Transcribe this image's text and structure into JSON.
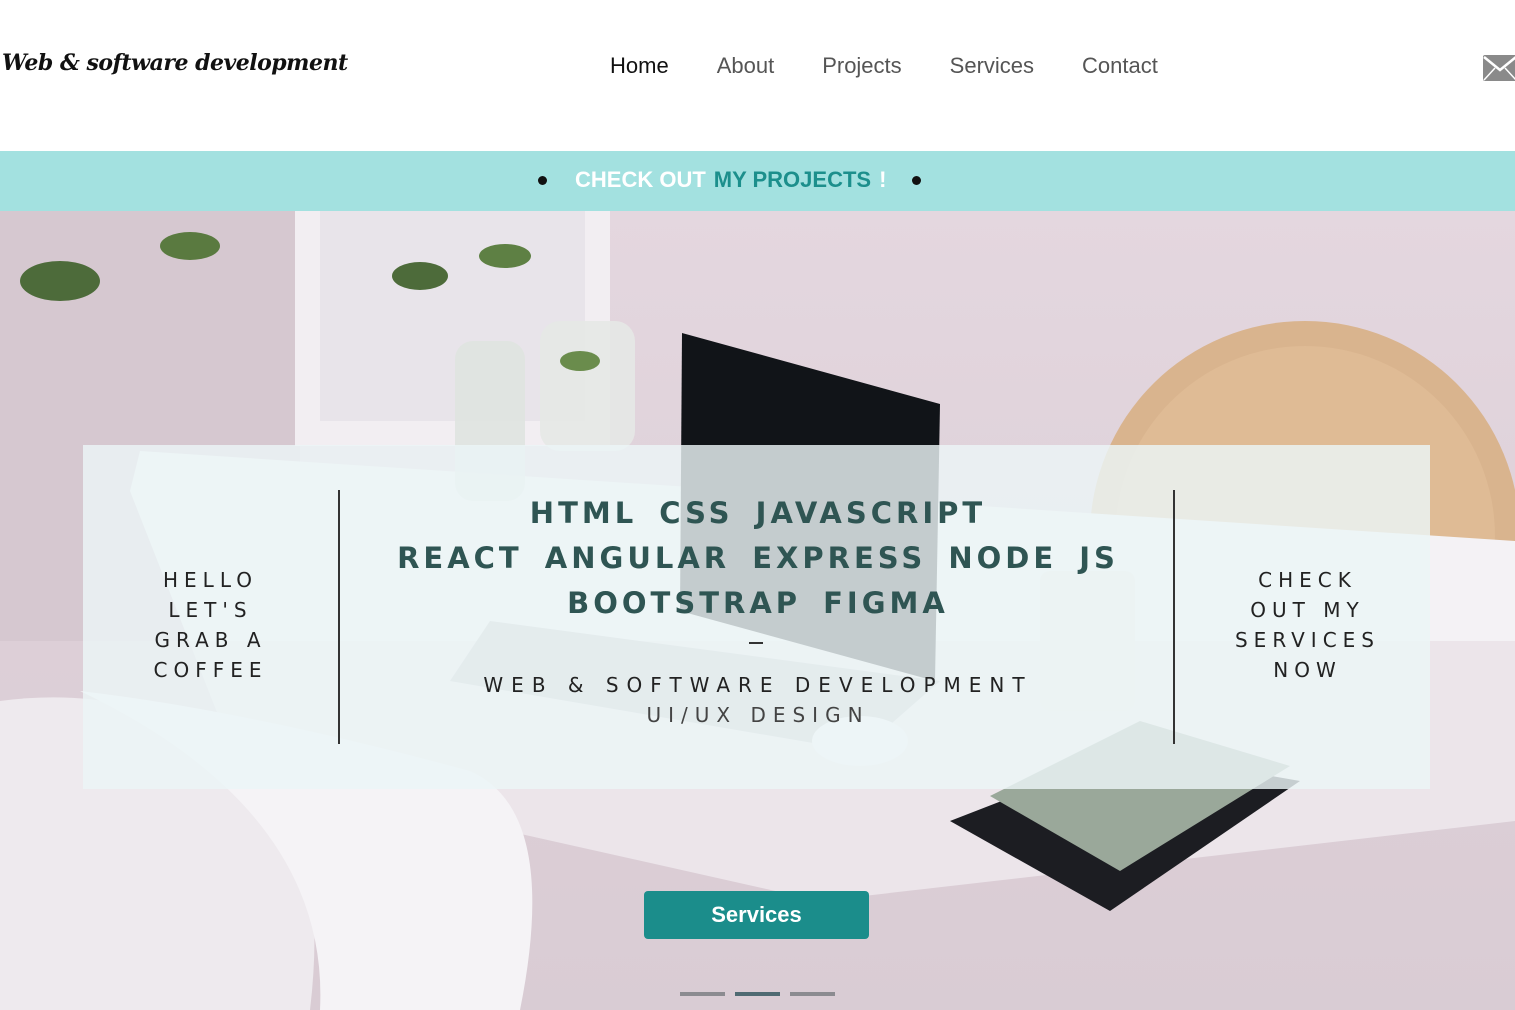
{
  "header": {
    "logo": "Web & software development",
    "nav": [
      {
        "label": "Home",
        "active": true
      },
      {
        "label": "About",
        "active": false
      },
      {
        "label": "Projects",
        "active": false
      },
      {
        "label": "Services",
        "active": false
      },
      {
        "label": "Contact",
        "active": false
      }
    ],
    "mail_icon": "mail-icon"
  },
  "banner": {
    "part1": "CHECK OUT",
    "part2": "MY PROJECTS",
    "part3": "!",
    "background": "#a3e1e0",
    "accent": "#1c8f8c"
  },
  "hero": {
    "left_text": [
      "HELLO",
      "LET'S",
      "GRAB A",
      "COFFEE"
    ],
    "tech_lines": [
      "HTML  CSS  JAVASCRIPT",
      "REACT  ANGULAR  EXPRESS  NODE JS",
      "BOOTSTRAP  FIGMA"
    ],
    "dash": "–",
    "subtitle1": "WEB & SOFTWARE DEVELOPMENT",
    "subtitle2": "UI/UX DESIGN",
    "right_text": [
      "CHECK",
      "OUT MY",
      "SERVICES",
      "NOW"
    ],
    "button_label": "Services",
    "button_color": "#1b8d8b",
    "carousel": {
      "slides": 3,
      "active_index": 1
    }
  }
}
